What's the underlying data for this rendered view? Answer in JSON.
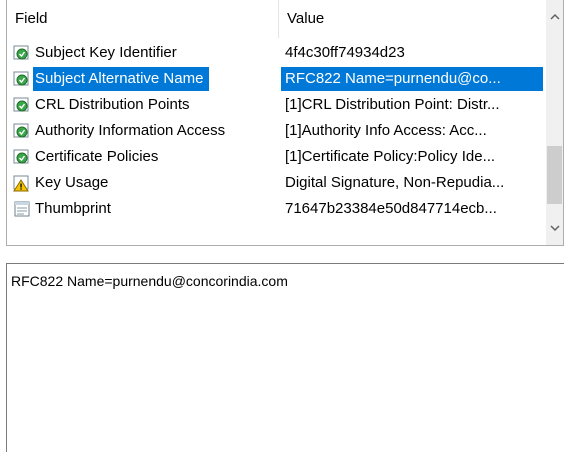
{
  "list": {
    "columns": {
      "field": "Field",
      "value": "Value"
    },
    "rows": [
      {
        "field": "Subject Key Identifier",
        "value": "4f4c30ff74934d23",
        "icon": "certificate-field-icon",
        "selected": false
      },
      {
        "field": "Subject Alternative Name",
        "value": "RFC822 Name=purnendu@co...",
        "icon": "certificate-field-icon",
        "selected": true
      },
      {
        "field": "CRL Distribution Points",
        "value": "[1]CRL Distribution Point: Distr...",
        "icon": "certificate-field-icon",
        "selected": false
      },
      {
        "field": "Authority Information Access",
        "value": "[1]Authority Info Access: Acc...",
        "icon": "certificate-field-icon",
        "selected": false
      },
      {
        "field": "Certificate Policies",
        "value": "[1]Certificate Policy:Policy Ide...",
        "icon": "certificate-field-icon",
        "selected": false
      },
      {
        "field": "Key Usage",
        "value": "Digital Signature, Non-Repudia...",
        "icon": "warning-icon",
        "selected": false
      },
      {
        "field": "Thumbprint",
        "value": "71647b23384e50d847714ecb...",
        "icon": "document-icon",
        "selected": false
      }
    ]
  },
  "detail": {
    "text": "RFC822 Name=purnendu@concorindia.com"
  },
  "colors": {
    "selection": "#0078d7",
    "scrollbar_track": "#f0f0f0",
    "scrollbar_thumb": "#cdcdcd"
  }
}
